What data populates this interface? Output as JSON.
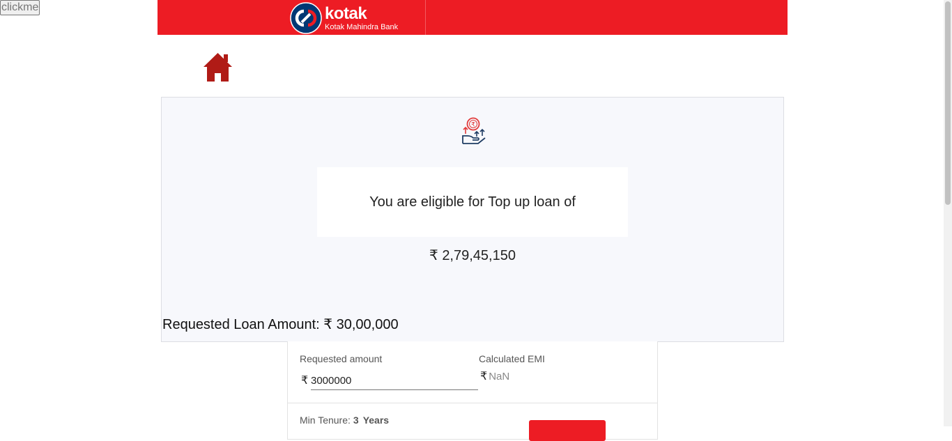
{
  "debug_button": {
    "label": "clickme"
  },
  "brand": {
    "name": "kotak",
    "subtitle": "Kotak Mahindra Bank",
    "primary_color": "#ed1c24",
    "logo_circle_color": "#003874"
  },
  "nav": {
    "home_icon": "home-icon",
    "home_color": "#b01b16"
  },
  "eligibility": {
    "icon": "loan-hand-rupee-icon",
    "message": "You are eligible for Top up loan of",
    "currency_symbol": "₹",
    "amount": "2,79,45,150"
  },
  "requested_loan": {
    "label": "Requested Loan Amount:",
    "currency_symbol": "₹",
    "amount": "30,00,000"
  },
  "calculator": {
    "requested_amount_label": "Requested amount",
    "requested_amount_currency": "₹",
    "requested_amount_value": "3000000",
    "emi_label": "Calculated EMI",
    "emi_currency": "₹",
    "emi_value": "NaN",
    "tenure_label": "Min Tenure:",
    "tenure_value": "3",
    "tenure_unit": "Years"
  }
}
